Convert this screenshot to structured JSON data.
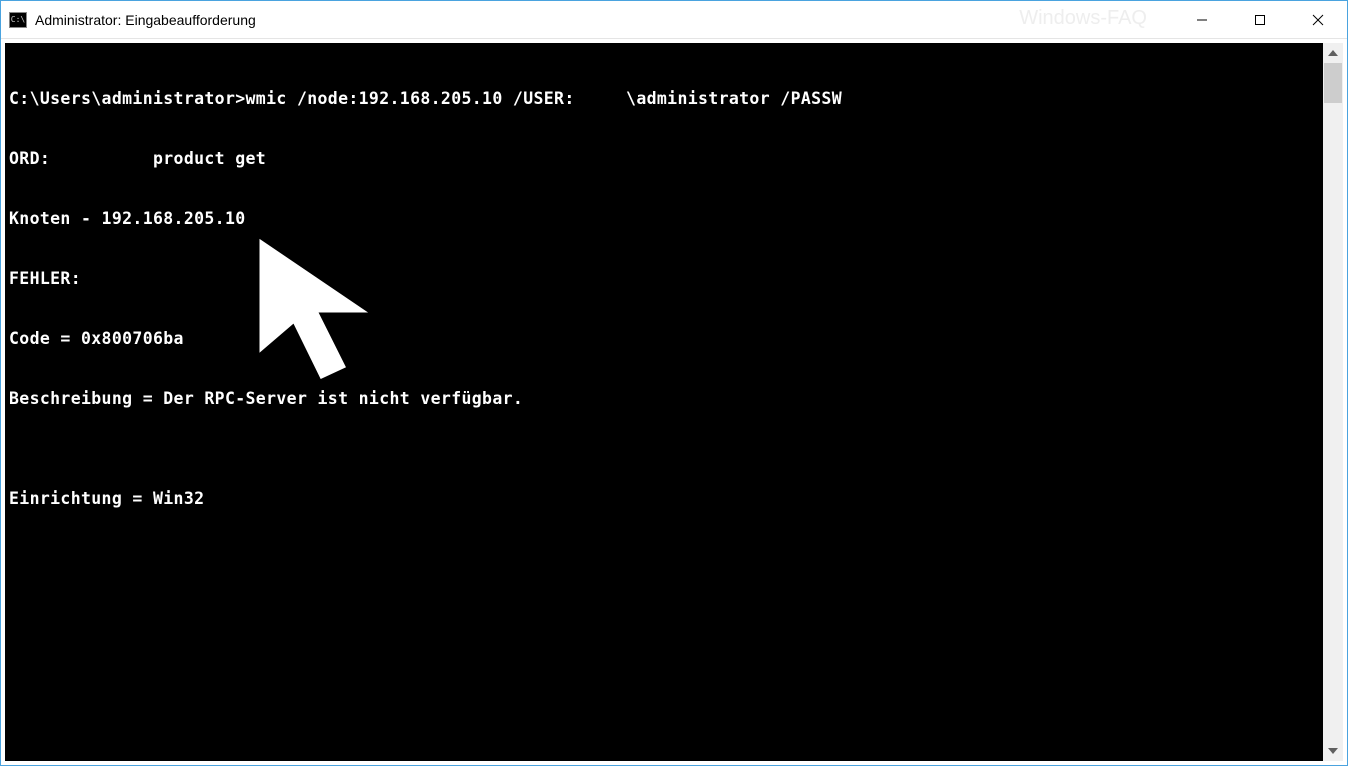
{
  "window": {
    "title": "Administrator: Eingabeaufforderung",
    "watermark": "Windows-FAQ"
  },
  "console": {
    "lines": [
      "C:\\Users\\administrator>wmic /node:192.168.205.10 /USER:     \\administrator /PASSW",
      "ORD:          product get",
      "Knoten - 192.168.205.10",
      "FEHLER:",
      "Code = 0x800706ba",
      "Beschreibung = Der RPC-Server ist nicht verfügbar.",
      "",
      "Einrichtung = Win32"
    ]
  }
}
